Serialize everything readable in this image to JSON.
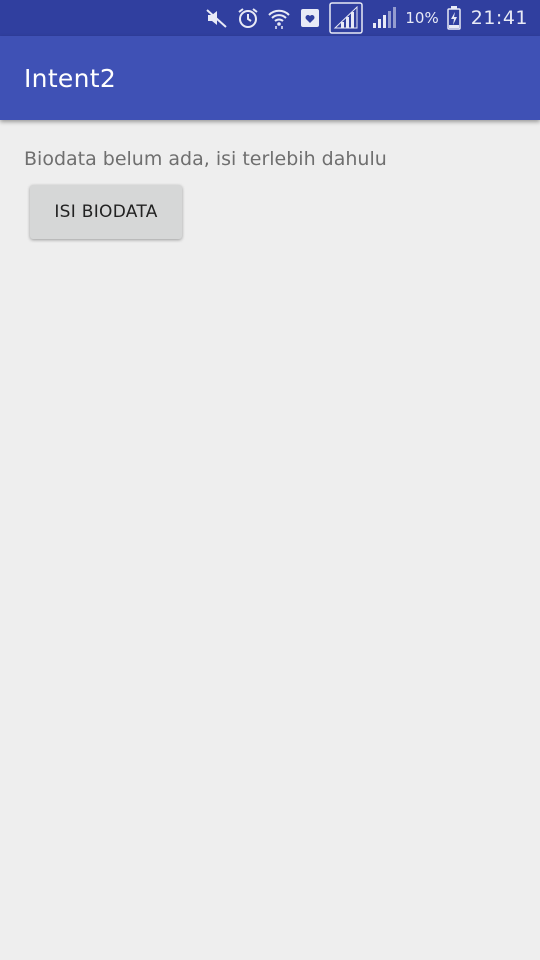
{
  "status_bar": {
    "icons": [
      "mute-icon",
      "alarm-icon",
      "wifi-icon",
      "notification-icon",
      "signal-icon",
      "signal-icon-2",
      "battery-charging-icon"
    ],
    "battery_percent": "10%",
    "time": "21:41"
  },
  "app_bar": {
    "title": "Intent2"
  },
  "main": {
    "message": "Biodata belum ada, isi terlebih dahulu",
    "button_label": "ISI BIODATA"
  },
  "colors": {
    "status_bar": "#303f9f",
    "app_bar": "#3f51b5",
    "background": "#eeeeee",
    "button": "#d6d7d7"
  }
}
